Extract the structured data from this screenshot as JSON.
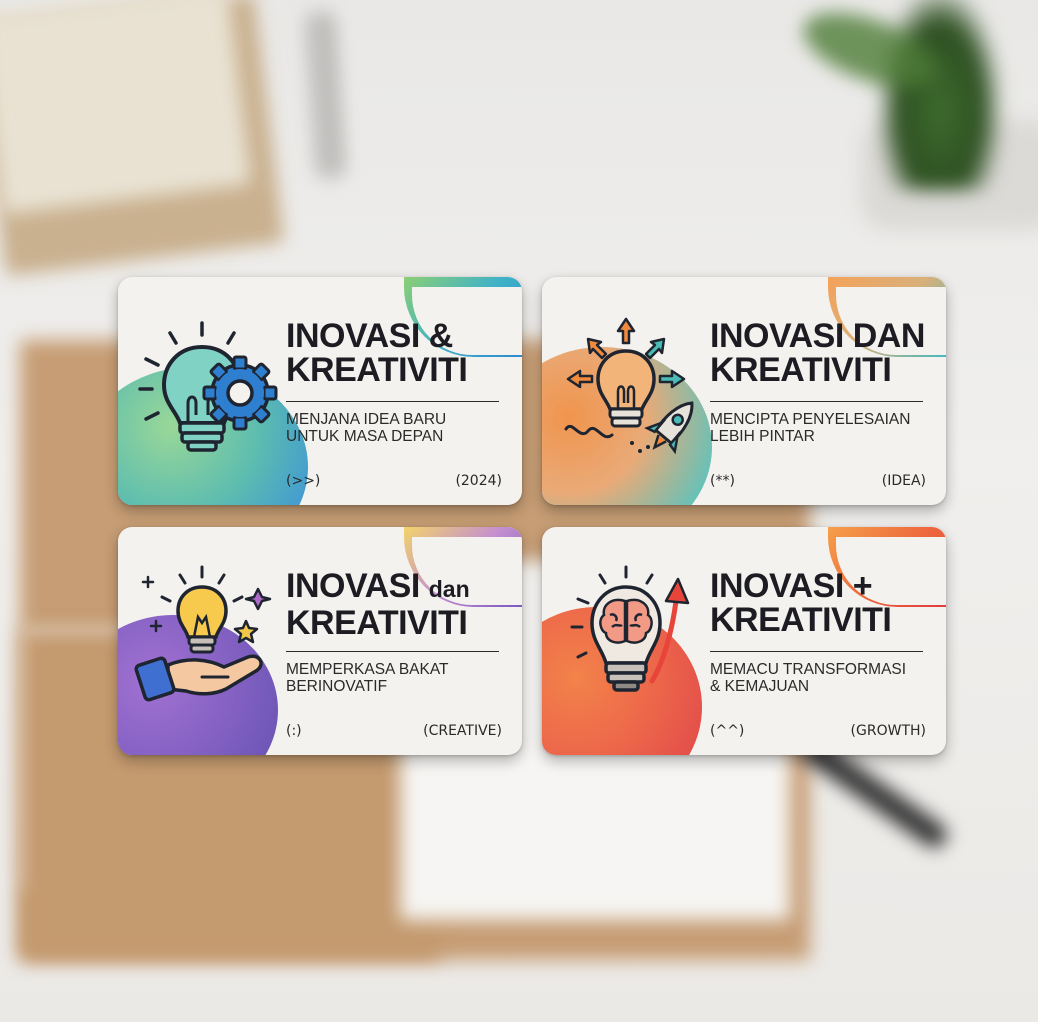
{
  "cards": [
    {
      "title_line1": "INOVASI &",
      "title_line2": "KREATIVITI",
      "sub_line1": "MENJANA IDEA BARU",
      "sub_line2": "UNTUK MASA DEPAN",
      "tag_left": "(>>)",
      "tag_right": "(2024)",
      "icon": "lightbulb-gear-icon",
      "colors": [
        "#7ecb8f",
        "#43b0c9",
        "#2c86c9"
      ]
    },
    {
      "title_line1": "INOVASI DAN",
      "title_line2": "KREATIVITI",
      "sub_line1": "MENCIPTA PENYELESAIAN",
      "sub_line2": "LEBIH PINTAR",
      "tag_left": "(**)",
      "tag_right": "(IDEA)",
      "icon": "lightbulb-rocket-icon",
      "colors": [
        "#f08a3c",
        "#e2a06a",
        "#4bbbb6"
      ]
    },
    {
      "title_line1_a": "INOVASI",
      "title_line1_b": "dan",
      "title_line2": "KREATIVITI",
      "sub_line1": "MEMPERKASA BAKAT",
      "sub_line2": "BERINOVATIF",
      "tag_left": "(:)",
      "tag_right": "(CREATIVE)",
      "icon": "hand-lightbulb-icon",
      "colors": [
        "#8b5ac4",
        "#6a4fb8",
        "#e3c14f"
      ]
    },
    {
      "title_line1": "INOVASI +",
      "title_line2": "KREATIVITI",
      "sub_line1": "MEMACU TRANSFORMASI",
      "sub_line2": "& KEMAJUAN",
      "tag_left": "(^^)",
      "tag_right": "(GROWTH)",
      "icon": "brain-lightbulb-icon",
      "colors": [
        "#ef5a3a",
        "#f08a3c",
        "#e0463c"
      ]
    }
  ]
}
